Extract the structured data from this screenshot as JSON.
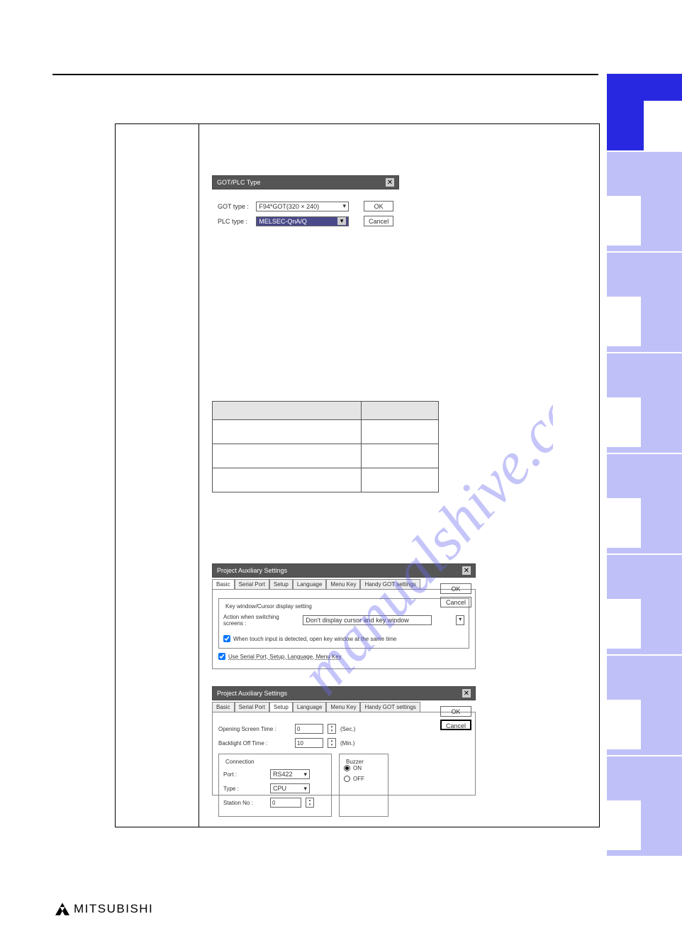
{
  "dlg1": {
    "title": "GOT/PLC Type",
    "got_label": "GOT type :",
    "got_value": "F94*GOT(320 × 240)",
    "plc_label": "PLC type :",
    "plc_value": "MELSEC-QnA/Q",
    "ok": "OK",
    "cancel": "Cancel"
  },
  "dlg2": {
    "title": "Project Auxiliary Settings",
    "tabs": [
      "Basic",
      "Serial Port",
      "Setup",
      "Language",
      "Menu Key",
      "Handy GOT settings"
    ],
    "fs_title": "Key window/Cursor display setting",
    "action_label": "Action when switching screens :",
    "action_value": "Don't display cursor and key window",
    "chk1": "When touch input is detected, open key window at the same time",
    "chk2": "Use Serial Port, Setup, Language, Menu Key",
    "ok": "OK",
    "cancel": "Cancel"
  },
  "dlg3": {
    "title": "Project Auxiliary Settings",
    "tabs": [
      "Basic",
      "Serial Port",
      "Setup",
      "Language",
      "Menu Key",
      "Handy GOT settings"
    ],
    "open_label": "Opening Screen Time :",
    "open_value": "0",
    "open_unit": "(Sec.)",
    "back_label": "Backlight Off Time :",
    "back_value": "10",
    "back_unit": "(Min.)",
    "conn_title": "Connection",
    "port_label": "Port :",
    "port_value": "RS422",
    "type_label": "Type :",
    "type_value": "CPU",
    "station_label": "Station No :",
    "station_value": "0",
    "buzzer_title": "Buzzer",
    "buzzer_on": "ON",
    "buzzer_off": "OFF",
    "ok": "OK",
    "cancel": "Cancel"
  },
  "logo": "MITSUBISHI",
  "watermark": "manualshive.com"
}
